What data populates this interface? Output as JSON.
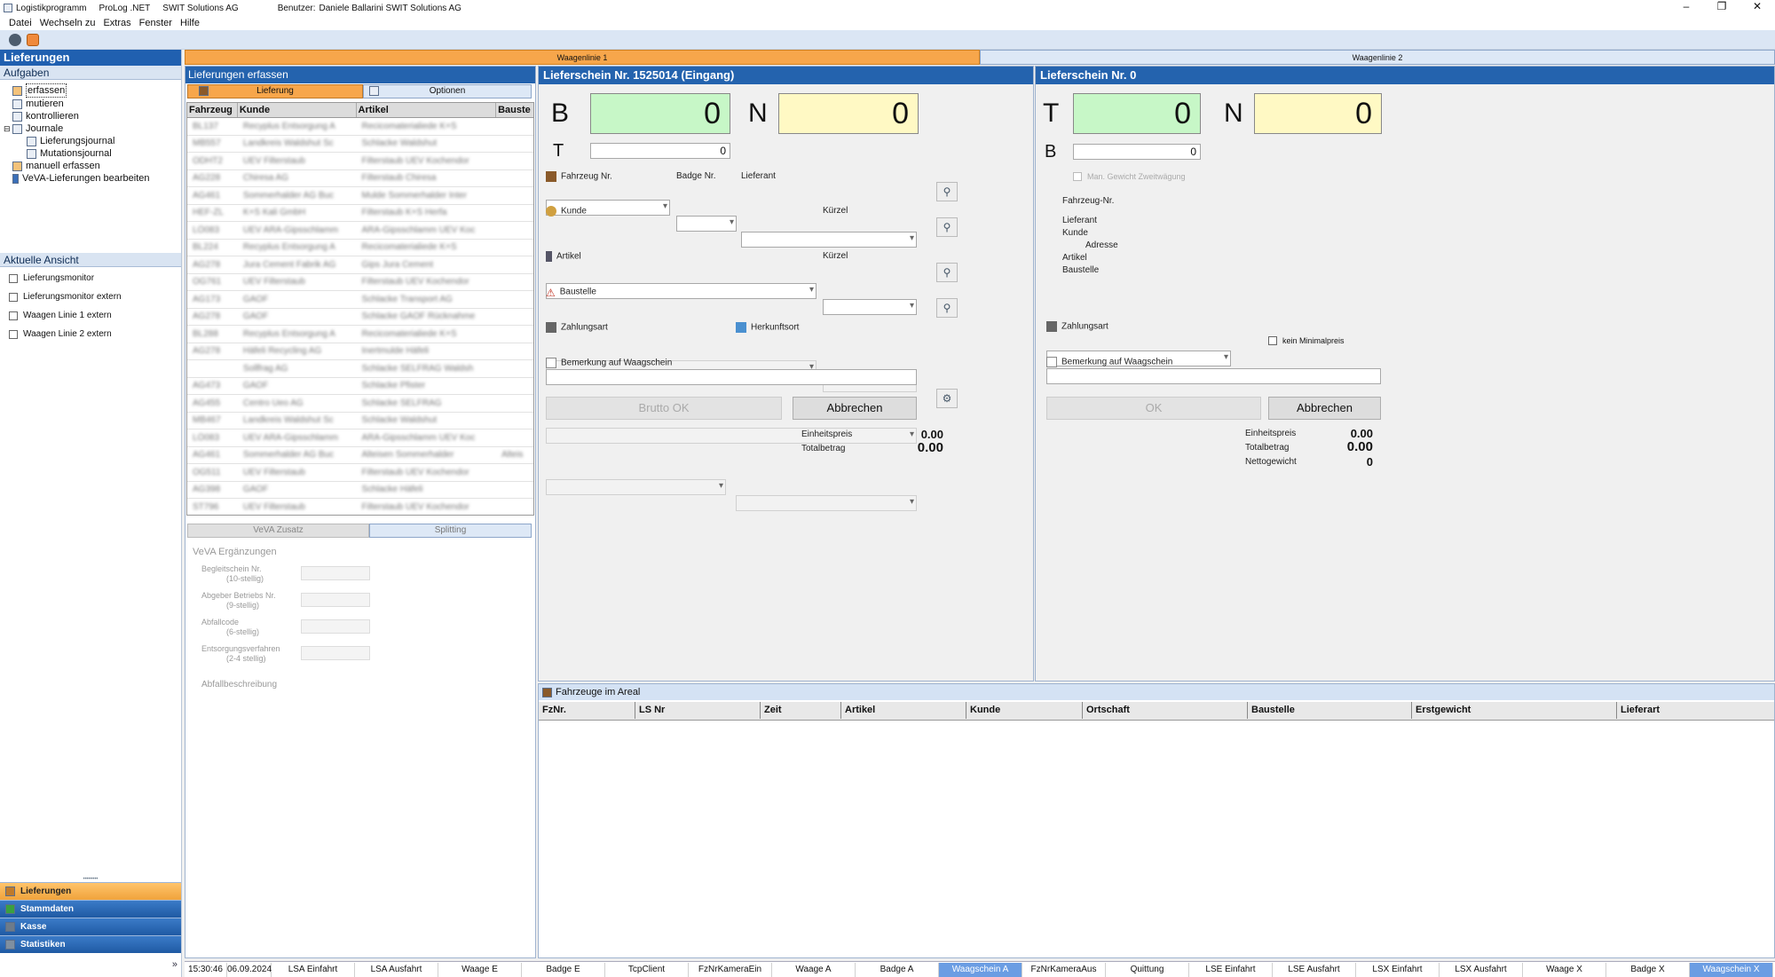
{
  "titlebar": {
    "app": "Logistikprogramm",
    "product": "ProLog .NET",
    "company": "SWIT Solutions AG",
    "user_label": "Benutzer:",
    "user": "Daniele Ballarini SWIT Solutions AG",
    "min": "–",
    "max": "❐",
    "close": "✕"
  },
  "menu": [
    "Datei",
    "Wechseln zu",
    "Extras",
    "Fenster",
    "Hilfe"
  ],
  "left": {
    "title": "Lieferungen",
    "tasks_header": "Aufgaben",
    "tree": [
      {
        "label": "erfassen",
        "level": 1
      },
      {
        "label": "mutieren",
        "level": 1
      },
      {
        "label": "kontrollieren",
        "level": 1
      },
      {
        "label": "Journale",
        "level": 1
      },
      {
        "label": "Lieferungsjournal",
        "level": 2
      },
      {
        "label": "Mutationsjournal",
        "level": 2
      },
      {
        "label": "manuell erfassen",
        "level": 1
      },
      {
        "label": "VeVA-Lieferungen bearbeiten",
        "level": 1
      }
    ],
    "view_header": "Aktuelle Ansicht",
    "views": [
      "Lieferungsmonitor",
      "Lieferungsmonitor extern",
      "Waagen Linie 1 extern",
      "Waagen Linie 2 extern"
    ],
    "nav": [
      {
        "label": "Lieferungen",
        "active": true
      },
      {
        "label": "Stammdaten",
        "active": false
      },
      {
        "label": "Kasse",
        "active": false
      },
      {
        "label": "Statistiken",
        "active": false
      }
    ],
    "expand": "»"
  },
  "waagen": {
    "tab1": "Waagenlinie 1",
    "tab2": "Waagenlinie 2"
  },
  "erfassen": {
    "header": "Lieferungen erfassen",
    "tab_lieferung": "Lieferung",
    "tab_optionen": "Optionen",
    "columns": [
      "Fahrzeug",
      "Kunde",
      "Artikel",
      "Bauste"
    ],
    "rows": [
      [
        "BL137",
        "Recyplus Entsorgung A",
        "Recicomaterialiede K+S",
        ""
      ],
      [
        "MB557",
        "Landkreis Waldshut Sc",
        "Schlacke Waldshut",
        ""
      ],
      [
        "ODHT2",
        "UEV Filterstaub",
        "Filterstaub UEV Kochendor",
        ""
      ],
      [
        "AG228",
        "Chiresa AG",
        "Filterstaub Chiresa",
        ""
      ],
      [
        "AG461",
        "Sommerhalder AG Buc",
        "Mulde Sommerhalder Inter",
        ""
      ],
      [
        "HEF-ZL",
        "K+S Kali GmbH",
        "Filterstaub K+S Herfa",
        ""
      ],
      [
        "LÖ083",
        "UEV ARA-Gipsschlamm",
        "ARA-Gipsschlamm UEV Koc",
        ""
      ],
      [
        "BL224",
        "Recyplus Entsorgung A",
        "Recicomaterialiede K+S",
        ""
      ],
      [
        "AG278",
        "Jura Cement Fabrik AG",
        "Gips Jura Cement",
        ""
      ],
      [
        "OG761",
        "UEV Filterstaub",
        "Filterstaub UEV Kochendor",
        ""
      ],
      [
        "AG173",
        "GAOF",
        "Schlacke Transport AG",
        ""
      ],
      [
        "AG278",
        "GAOF",
        "Schlacke GAOF Rücknahme",
        ""
      ],
      [
        "BL288",
        "Recyplus Entsorgung A",
        "Recicomaterialiede K+S",
        ""
      ],
      [
        "AG278",
        "Häfeli Recycling AG",
        "Inertmulde Häfeli",
        ""
      ],
      [
        "",
        "Sollfrag AG",
        "Schlacke SELFRAG Waldsh",
        ""
      ],
      [
        "AG473",
        "GAOF",
        "Schlacke Pfister",
        ""
      ],
      [
        "AG455",
        "Centro Ueo AG",
        "Schlacke SELFRAG",
        ""
      ],
      [
        "MB467",
        "Landkreis Waldshut Sc",
        "Schlacke Waldshut",
        ""
      ],
      [
        "LÖ083",
        "UEV ARA-Gipsschlamm",
        "ARA-Gipsschlamm UEV Koc",
        ""
      ],
      [
        "AG461",
        "Sommerhalder AG Buc",
        "Alteisen Sommerhalder",
        "Alteis"
      ],
      [
        "OG511",
        "UEV Filterstaub",
        "Filterstaub UEV Kochendor",
        ""
      ],
      [
        "AG398",
        "GAOF",
        "Schlacke Häfeli",
        ""
      ],
      [
        "ST796",
        "UEV Filterstaub",
        "Filterstaub UEV Kochendor",
        ""
      ]
    ],
    "tab_veva": "VeVA Zusatz",
    "tab_splitting": "Splitting",
    "veva_title": "VeVA Ergänzungen",
    "veva_fields": [
      {
        "l1": "Begleitschein Nr.",
        "l2": "(10-stellig)"
      },
      {
        "l1": "Abgeber Betriebs Nr.",
        "l2": "(9-stellig)"
      },
      {
        "l1": "Abfallcode",
        "l2": "(6-stellig)"
      },
      {
        "l1": "Entsorgungsverfahren",
        "l2": "(2-4 stellig)"
      }
    ],
    "veva_desc": "Abfallbeschreibung"
  },
  "ls1": {
    "header": "Lieferschein Nr.   1525014 (Eingang)",
    "B_label": "B",
    "B_value": "0",
    "N_label": "N",
    "N_value": "0",
    "T_label": "T",
    "T_value": "0",
    "fahrzeug": "Fahrzeug Nr.",
    "badge": "Badge Nr.",
    "lieferant": "Lieferant",
    "kunde": "Kunde",
    "kuerzel": "Kürzel",
    "artikel": "Artikel",
    "kuerzel2": "Kürzel",
    "baustelle": "Baustelle",
    "zahlungsart": "Zahlungsart",
    "herkunft": "Herkunftsort",
    "bemerkung": "Bemerkung auf Waagschein",
    "btn_ok": "Brutto OK",
    "btn_cancel": "Abbrechen",
    "einheitspreis_label": "Einheitspreis",
    "einheitspreis": "0.00",
    "totalbetrag_label": "Totalbetrag",
    "totalbetrag": "0.00"
  },
  "ls2": {
    "header": "Lieferschein Nr.   0",
    "T_label": "T",
    "T_value": "0",
    "N_label": "N",
    "N_value": "0",
    "B_label": "B",
    "B_value": "0",
    "man_gewicht": "Man. Gewicht Zweitwägung",
    "info": [
      "Fahrzeug-Nr.",
      "Lieferant",
      "Kunde",
      "Adresse",
      "Artikel",
      "Baustelle"
    ],
    "zahlungsart": "Zahlungsart",
    "kein_minimal": "kein Minimalpreis",
    "bemerkung": "Bemerkung auf Waagschein",
    "btn_ok": "OK",
    "btn_cancel": "Abbrechen",
    "einheitspreis_label": "Einheitspreis",
    "einheitspreis": "0.00",
    "totalbetrag_label": "Totalbetrag",
    "totalbetrag": "0.00",
    "netto_label": "Nettogewicht",
    "netto": "0"
  },
  "areal": {
    "header": "Fahrzeuge im Areal",
    "columns": [
      "FzNr.",
      "LS Nr",
      "Zeit",
      "Artikel",
      "Kunde",
      "Ortschaft",
      "Baustelle",
      "Erstgewicht",
      "Lieferart"
    ]
  },
  "status": {
    "time": "15:30:46",
    "date": "06.09.2024",
    "items": [
      {
        "label": "LSA Einfahrt",
        "active": false
      },
      {
        "label": "LSA Ausfahrt",
        "active": false
      },
      {
        "label": "Waage E",
        "active": false
      },
      {
        "label": "Badge E",
        "active": false
      },
      {
        "label": "TcpClient",
        "active": false
      },
      {
        "label": "FzNrKameraEin",
        "active": false
      },
      {
        "label": "Waage A",
        "active": false
      },
      {
        "label": "Badge A",
        "active": false
      },
      {
        "label": "Waagschein A",
        "active": true
      },
      {
        "label": "FzNrKameraAus",
        "active": false
      },
      {
        "label": "Quittung",
        "active": false
      },
      {
        "label": "LSE Einfahrt",
        "active": false
      },
      {
        "label": "LSE Ausfahrt",
        "active": false
      },
      {
        "label": "LSX Einfahrt",
        "active": false
      },
      {
        "label": "LSX Ausfahrt",
        "active": false
      },
      {
        "label": "Waage X",
        "active": false
      },
      {
        "label": "Badge X",
        "active": false
      },
      {
        "label": "Waagschein X",
        "active": true
      }
    ]
  },
  "colors": {
    "accent": "#2463ae",
    "active_tab": "#f7a64b",
    "weight_green": "#c7f7c7",
    "weight_yellow": "#fff9c4"
  }
}
